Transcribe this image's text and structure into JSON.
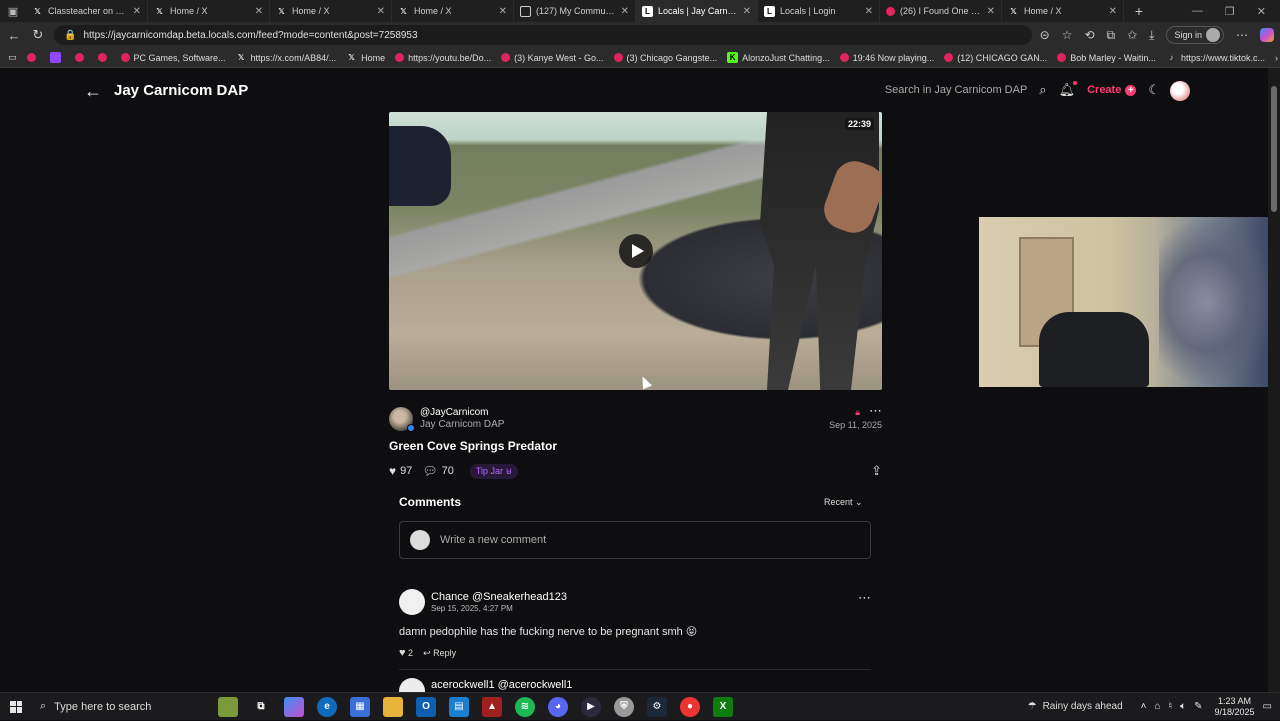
{
  "browser": {
    "tabs": [
      {
        "title": "Classteacher on X: \"Ty",
        "icon": "x-icon"
      },
      {
        "title": "Home / X",
        "icon": "x-icon"
      },
      {
        "title": "Home / X",
        "icon": "x-icon"
      },
      {
        "title": "Home / X",
        "icon": "x-icon"
      },
      {
        "title": "(127) My Communities",
        "icon": "box-icon"
      },
      {
        "title": "Locals | Jay Carnicom D",
        "icon": "locals-icon"
      },
      {
        "title": "Locals | Login",
        "icon": "locals-icon"
      },
      {
        "title": "(26) I Found One of the",
        "icon": "youtube-icon"
      },
      {
        "title": "Home / X",
        "icon": "x-icon"
      }
    ],
    "url": "https://jaycarnicomdap.beta.locals.com/feed?mode=content&post=7258953",
    "sign_in": "Sign in",
    "bookmarks": [
      {
        "label": ""
      },
      {
        "label": ""
      },
      {
        "label": ""
      },
      {
        "label": ""
      },
      {
        "label": "PC Games, Software..."
      },
      {
        "label": "https://x.com/AB84/..."
      },
      {
        "label": "Home"
      },
      {
        "label": "https://youtu.be/Do..."
      },
      {
        "label": "(3) Kanye West - Go..."
      },
      {
        "label": "(3) Chicago Gangste..."
      },
      {
        "label": "AlonzoJust Chatting..."
      },
      {
        "label": "19:46 Now playing..."
      },
      {
        "label": "(12) CHICAGO GAN..."
      },
      {
        "label": "Bob Marley - Waitin..."
      },
      {
        "label": "https://www.tiktok.c..."
      }
    ]
  },
  "page": {
    "site_title": "Jay Carnicom DAP",
    "search_label": "Search in Jay Carnicom DAP",
    "create_label": "Create",
    "video": {
      "duration": "22:39"
    },
    "author": {
      "handle": "@JayCarnicom",
      "community": "Jay Carnicom DAP",
      "date": "Sep 11, 2025"
    },
    "post_title": "Green Cove Springs Predator",
    "likes": "97",
    "comments_count": "70",
    "tip_jar": "Tip Jar",
    "comments": {
      "heading": "Comments",
      "sort": "Recent",
      "placeholder": "Write a new comment",
      "items": [
        {
          "name": "Chance  @Sneakerhead123",
          "time": "Sep 15, 2025, 4:27 PM",
          "body": "damn pedophile has the fucking nerve to be pregnant smh 😝",
          "likes": "2",
          "reply": "Reply"
        },
        {
          "name": "acerockwell1  @acerockwell1"
        }
      ]
    }
  },
  "taskbar": {
    "search_placeholder": "Type here to search",
    "weather": "Rainy days ahead",
    "time": "1:23 AM",
    "date": "9/18/2025"
  }
}
